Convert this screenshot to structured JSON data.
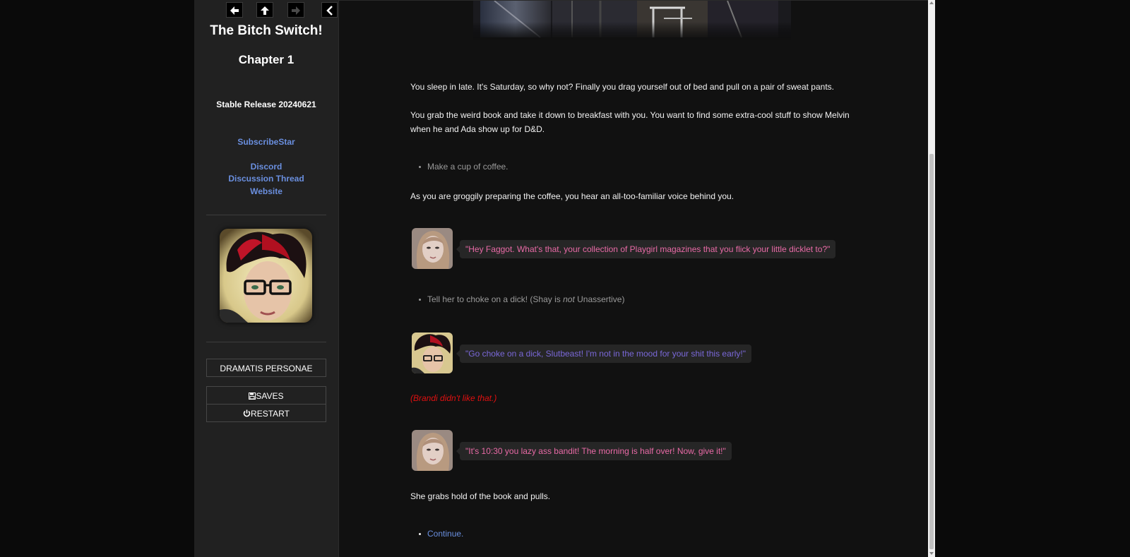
{
  "sidebar": {
    "history": {
      "back_icon": "arrow-left-icon",
      "up_icon": "arrow-up-icon",
      "forward_icon": "arrow-right-icon",
      "stow_icon": "chevron-left-icon"
    },
    "title": "The Bitch Switch!",
    "chapter": "Chapter 1",
    "release": "Stable Release 20240621",
    "links": {
      "subscribestar": "SubscribeStar",
      "discord": "Discord",
      "discussion_thread": "Discussion Thread",
      "website": "Website"
    },
    "buttons": {
      "dramatis": "DRAMATIS PERSONAE",
      "saves": "SAVES",
      "saves_icon": "floppy-disk-icon",
      "restart": "RESTART",
      "restart_icon": "power-icon"
    },
    "link_color": "#6a8fdf"
  },
  "story": {
    "p1": "You sleep in late. It's Saturday, so why not? Finally you drag yourself out of bed and pull on a pair of sweat pants.",
    "p2": "You grab the weird book and take it down to breakfast with you. You want to find some extra-cool stuff to show Melvin when he and Ada show up for D&D.",
    "choice1": "Make a cup of coffee.",
    "p3": "As you are groggily preparing the coffee, you hear an all-too-familiar voice behind you.",
    "speech1": "\"Hey Faggot. What's that, your collection of Playgirl magazines that you flick your little dicklet to?\"",
    "choice2_pre": "Tell her to choke on a dick! (Shay is ",
    "choice2_em": "not",
    "choice2_post": " Unassertive)",
    "speech2": "\"Go choke on a dick, Slutbeast! I'm not in the mood for your shit this early!\"",
    "reaction": "(Brandi didn't like that.)",
    "speech3": "\"It's 10:30 you lazy ass bandit! The morning is half over! Now, give it!\"",
    "p4": "She grabs hold of the book and pulls.",
    "continue": "Continue.",
    "colors": {
      "brandi_speech": "#e86aa6",
      "shay_speech": "#7a68d8",
      "reaction": "#e01010"
    }
  }
}
